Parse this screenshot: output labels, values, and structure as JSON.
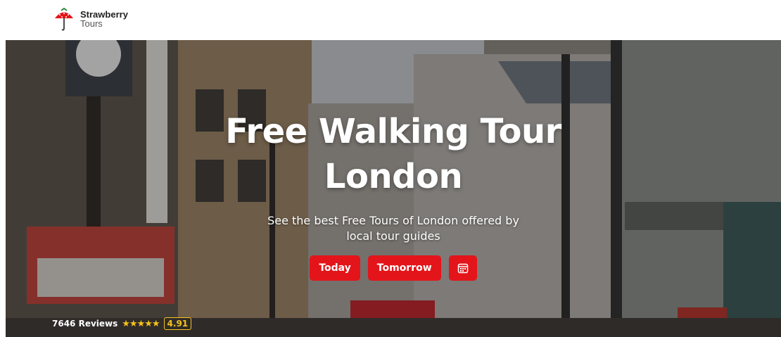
{
  "brand": {
    "name": "Strawberry",
    "sub": "Tours",
    "accent": "#e3151a"
  },
  "hero": {
    "title": "Free Walking Tour London",
    "subtitle": "See the best Free Tours of London offered by local tour guides",
    "buttons": {
      "today": "Today",
      "tomorrow": "Tomorrow",
      "calendar_icon": "calendar-icon"
    },
    "reviews": {
      "count_label": "7646 Reviews",
      "stars": "★★★★★",
      "rating": "4.91",
      "star_color": "#f6c21b"
    }
  }
}
